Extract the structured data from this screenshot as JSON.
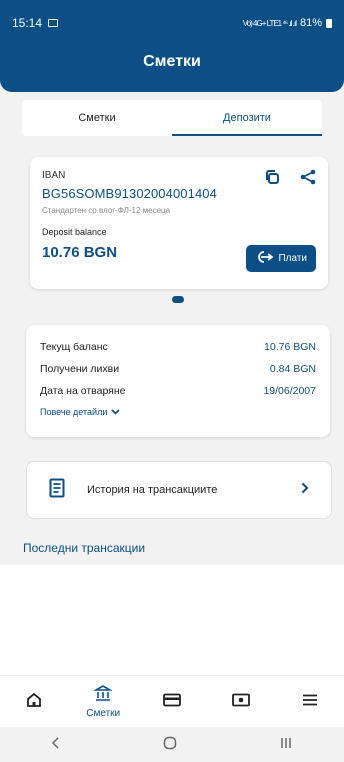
{
  "status_bar": {
    "time": "15:14",
    "signal_text": "Vo) 4G+ LTE1 ⁴⁶ .ıl .ıl",
    "battery": "81%"
  },
  "header": {
    "title": "Сметки"
  },
  "tabs": [
    {
      "label": "Сметки",
      "active": false
    },
    {
      "label": "Депозити",
      "active": true
    }
  ],
  "account_card": {
    "iban_label": "IBAN",
    "iban": "BG56SOMB91302004001404",
    "product": "Стандартен ср.влог-ФЛ-12 месеца",
    "balance_label": "Deposit balance",
    "balance": "10.76 BGN",
    "pay_label": "Плати"
  },
  "details": {
    "rows": [
      {
        "label": "Текущ баланс",
        "value": "10.76 BGN"
      },
      {
        "label": "Получени лихви",
        "value": "0.84 BGN"
      },
      {
        "label": "Дата на отваряне",
        "value": "19/06/2007"
      }
    ],
    "more_label": "Повече детайли"
  },
  "history": {
    "label": "История на трансакциите"
  },
  "recent_title": "Последни трансакции",
  "bottom_nav": {
    "accounts_label": "Сметки"
  },
  "colors": {
    "primary": "#0b4f86"
  }
}
